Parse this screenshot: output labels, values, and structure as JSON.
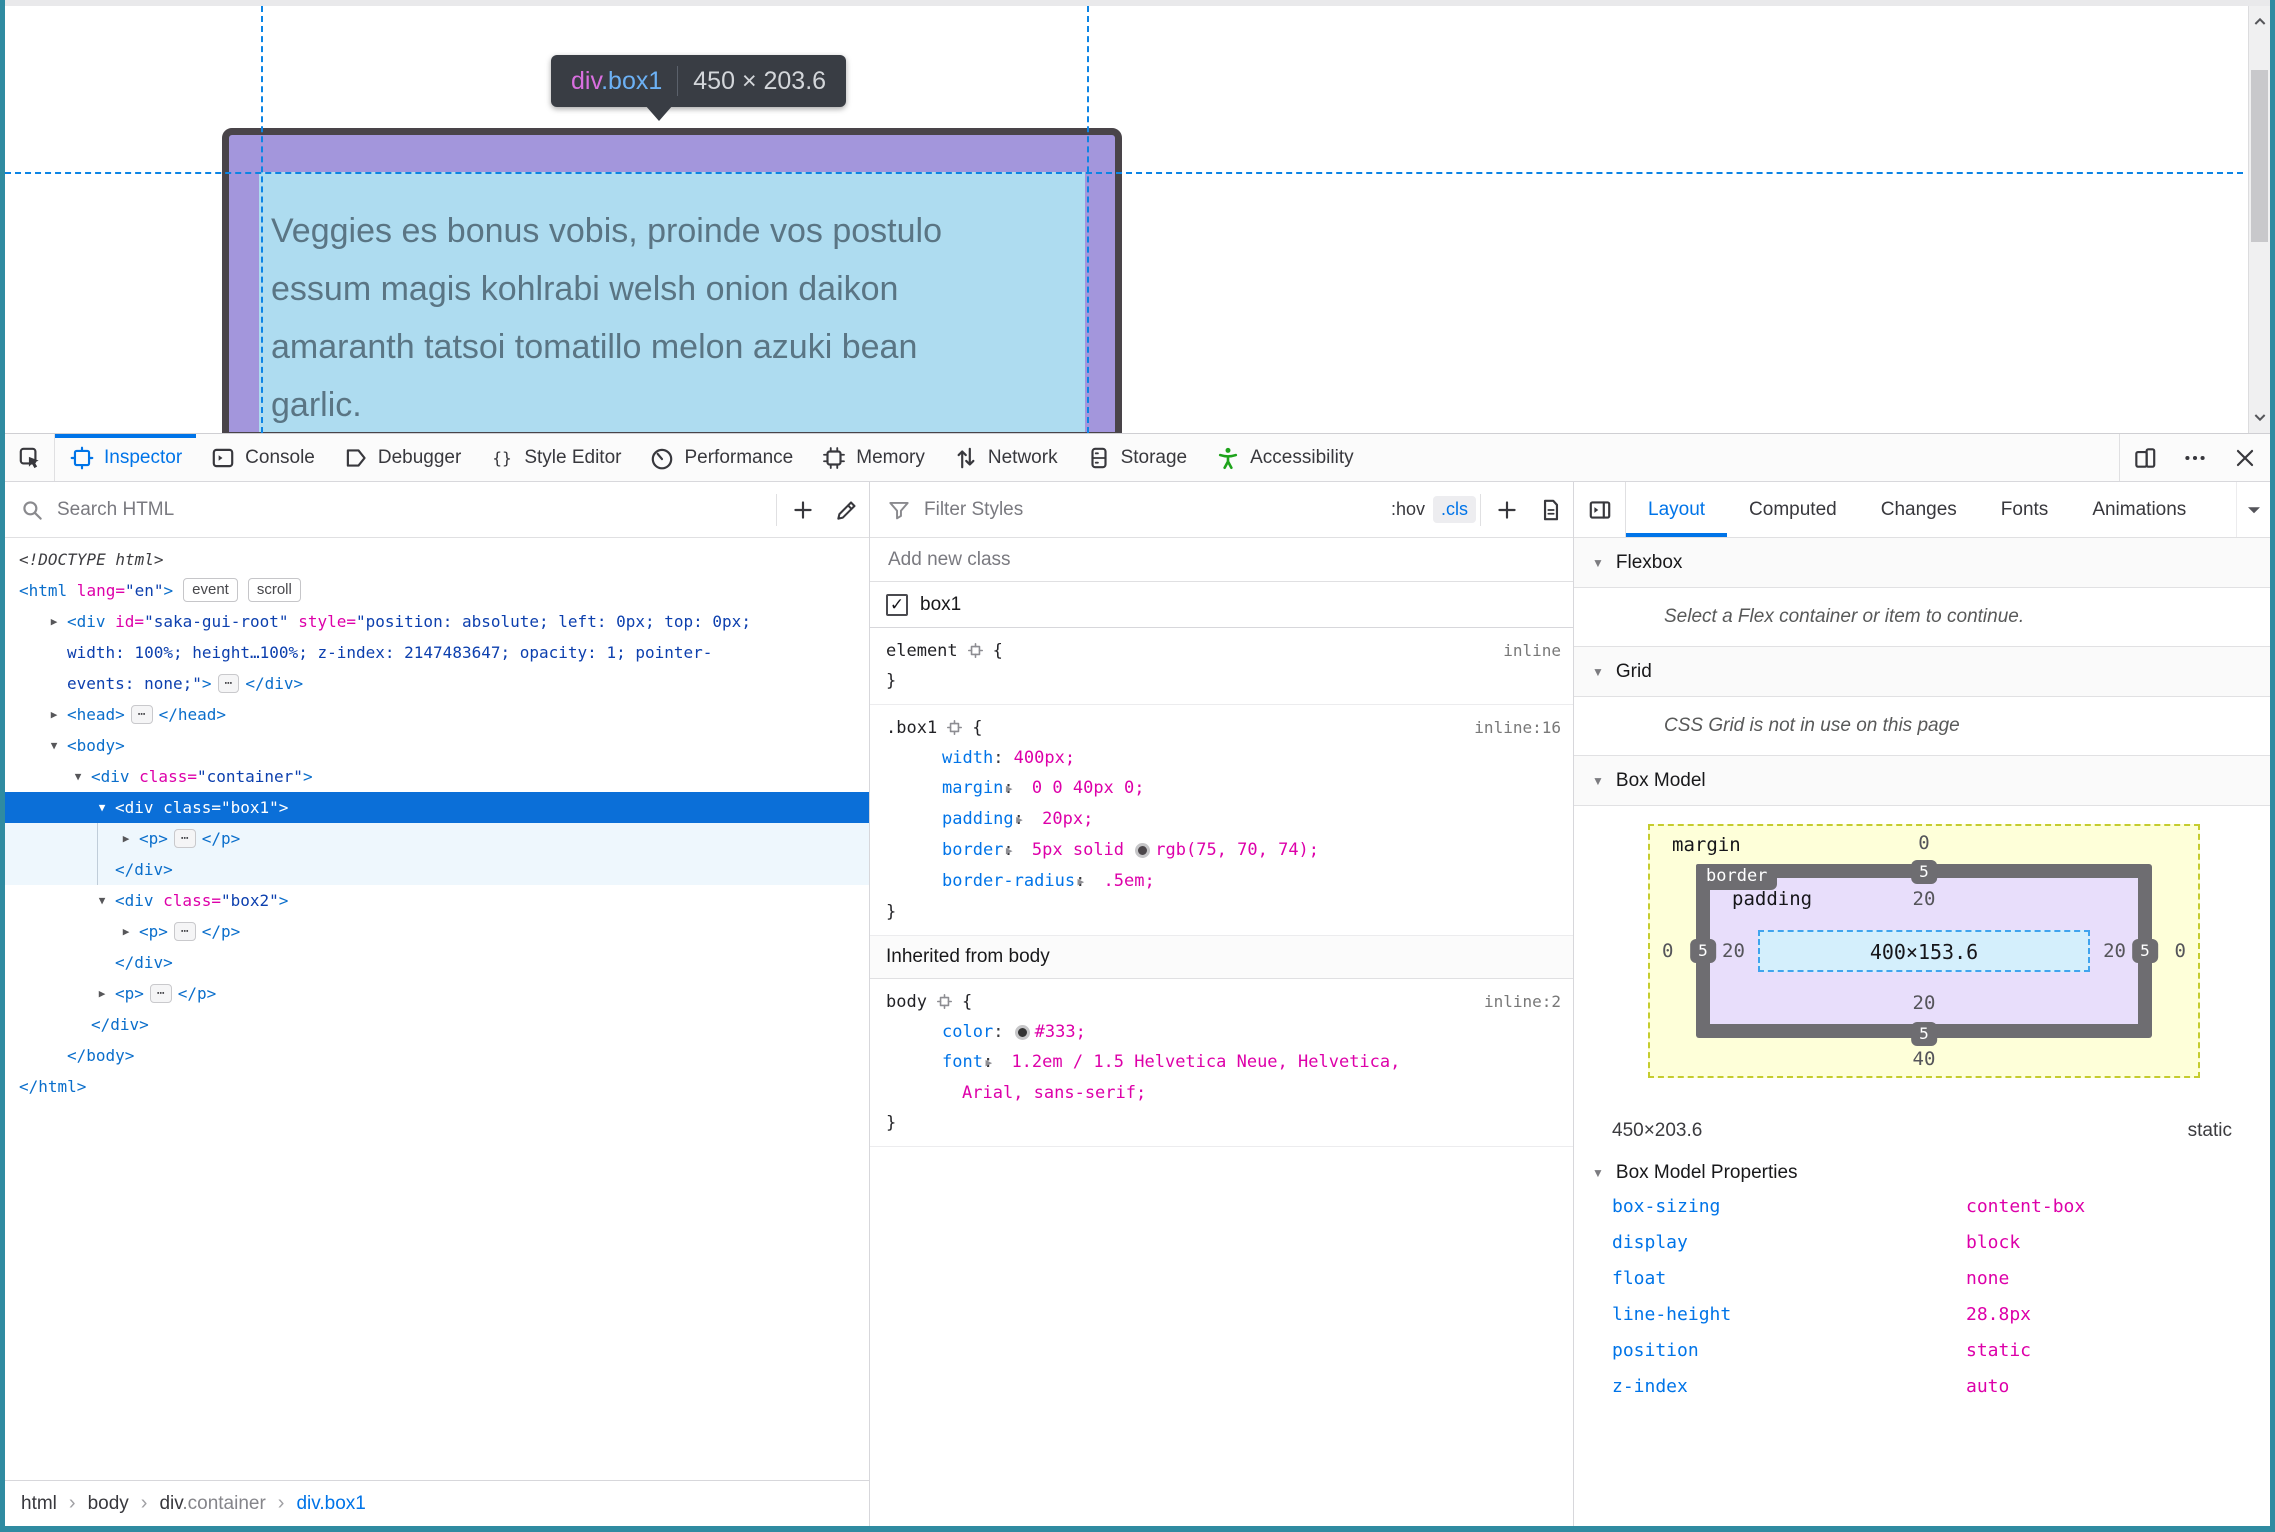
{
  "page": {
    "tooltip": {
      "tag": "div",
      "cls": ".box1",
      "dims": "450 × 203.6"
    },
    "paragraph": "Veggies es bonus vobis, proinde vos postulo essum magis kohlrabi welsh onion daikon amaranth tatsoi tomatillo melon azuki bean garlic.",
    "overlay_colors": {
      "border": "#494449",
      "padding": "#a396dc",
      "content": "#aedcf0",
      "guide": "#0c84e4"
    }
  },
  "toolbar": {
    "tabs": [
      {
        "label": "Inspector",
        "icon": "inspector",
        "active": true
      },
      {
        "label": "Console",
        "icon": "console"
      },
      {
        "label": "Debugger",
        "icon": "debugger"
      },
      {
        "label": "Style Editor",
        "icon": "style-editor"
      },
      {
        "label": "Performance",
        "icon": "performance"
      },
      {
        "label": "Memory",
        "icon": "memory"
      },
      {
        "label": "Network",
        "icon": "network"
      },
      {
        "label": "Storage",
        "icon": "storage"
      },
      {
        "label": "Accessibility",
        "icon": "accessibility",
        "accent": "#1ea31b"
      }
    ],
    "right_icons": [
      "responsive-mode",
      "meatball-menu",
      "close"
    ]
  },
  "markup": {
    "search_placeholder": "Search HTML",
    "lines": [
      {
        "i": 0,
        "toks": [
          [
            "d",
            "<!DOCTYPE html>"
          ]
        ]
      },
      {
        "i": 0,
        "toks": [
          [
            "t",
            "<html"
          ],
          [
            "a",
            " lang="
          ],
          [
            "v",
            "\"en\""
          ],
          [
            "t",
            ">"
          ],
          [
            "badge",
            "event"
          ],
          [
            "badge",
            "scroll"
          ]
        ]
      },
      {
        "i": 1,
        "a": "r",
        "wrap": true,
        "toks": [
          [
            "t",
            "<div"
          ],
          [
            "a",
            " id="
          ],
          [
            "v",
            "\"saka-gui-root\""
          ],
          [
            "a",
            " style="
          ],
          [
            "v",
            "\"position: absolute; left: 0px; top: 0px; width: 100%; height…100%; z-index: 2147483647; opacity: 1; pointer-events: none;\""
          ],
          [
            "t",
            ">"
          ],
          [
            "chip",
            "⋯"
          ],
          [
            "t",
            "</div>"
          ]
        ]
      },
      {
        "i": 1,
        "a": "r",
        "toks": [
          [
            "t",
            "<head>"
          ],
          [
            "chip",
            "⋯"
          ],
          [
            "t",
            "</head>"
          ]
        ]
      },
      {
        "i": 1,
        "a": "d",
        "toks": [
          [
            "t",
            "<body>"
          ]
        ]
      },
      {
        "i": 2,
        "a": "d",
        "toks": [
          [
            "t",
            "<div"
          ],
          [
            "a",
            " class="
          ],
          [
            "v",
            "\"container\""
          ],
          [
            "t",
            ">"
          ]
        ]
      },
      {
        "i": 3,
        "a": "d",
        "sel": true,
        "toks": [
          [
            "t",
            "<div"
          ],
          [
            "a",
            " class="
          ],
          [
            "v",
            "\"box1\""
          ],
          [
            "t",
            ">"
          ]
        ]
      },
      {
        "i": 4,
        "a": "r",
        "hl": true,
        "toks": [
          [
            "t",
            "<p>"
          ],
          [
            "chip",
            "⋯"
          ],
          [
            "t",
            "</p>"
          ]
        ]
      },
      {
        "i": 4,
        "hl": true,
        "toks": [
          [
            "t",
            "</div>"
          ]
        ]
      },
      {
        "i": 3,
        "a": "d",
        "toks": [
          [
            "t",
            "<div"
          ],
          [
            "a",
            " class="
          ],
          [
            "v",
            "\"box2\""
          ],
          [
            "t",
            ">"
          ]
        ]
      },
      {
        "i": 4,
        "a": "r",
        "toks": [
          [
            "t",
            "<p>"
          ],
          [
            "chip",
            "⋯"
          ],
          [
            "t",
            "</p>"
          ]
        ]
      },
      {
        "i": 4,
        "toks": [
          [
            "t",
            "</div>"
          ]
        ]
      },
      {
        "i": 3,
        "a": "r",
        "toks": [
          [
            "t",
            "<p>"
          ],
          [
            "chip",
            "⋯"
          ],
          [
            "t",
            "</p>"
          ]
        ]
      },
      {
        "i": 3,
        "toks": [
          [
            "t",
            "</div>"
          ]
        ]
      },
      {
        "i": 2,
        "toks": [
          [
            "t",
            "</body>"
          ]
        ]
      },
      {
        "i": 0,
        "toks": [
          [
            "t",
            "</html>"
          ]
        ]
      }
    ]
  },
  "rules": {
    "filter_placeholder": "Filter Styles",
    "hov_label": ":hov",
    "cls_label": ".cls",
    "add_class_placeholder": "Add new class",
    "class_toggle": {
      "checked": true,
      "label": "box1"
    },
    "blocks": [
      {
        "type": "rule",
        "selector": "element",
        "loc": "inline",
        "props": []
      },
      {
        "type": "rule",
        "selector": ".box1",
        "loc": "inline:16",
        "props": [
          {
            "n": "width",
            "v": "400px"
          },
          {
            "n": "margin",
            "ar": true,
            "v": "0 0 40px 0"
          },
          {
            "n": "padding",
            "ar": true,
            "v": "20px"
          },
          {
            "n": "border",
            "ar": true,
            "pre": "5px solid ",
            "sw": "#4b464a",
            "v": "rgb(75, 70, 74)"
          },
          {
            "n": "border-radius",
            "ar": true,
            "v": ".5em"
          }
        ]
      },
      {
        "type": "header",
        "text": "Inherited from body"
      },
      {
        "type": "rule",
        "selector": "body",
        "loc": "inline:2",
        "props": [
          {
            "n": "color",
            "sw": "#333",
            "v": "#333"
          },
          {
            "n": "font",
            "ar": true,
            "v": "1.2em / 1.5 Helvetica Neue, Helvetica, Arial, sans-serif"
          }
        ]
      }
    ]
  },
  "layout_panel": {
    "tabs": [
      {
        "label": "Layout",
        "active": true
      },
      {
        "label": "Computed"
      },
      {
        "label": "Changes"
      },
      {
        "label": "Fonts"
      },
      {
        "label": "Animations"
      }
    ],
    "flexbox": {
      "title": "Flexbox",
      "message": "Select a Flex container or item to continue."
    },
    "grid": {
      "title": "Grid",
      "message": "CSS Grid is not in use on this page"
    },
    "box_model": {
      "title": "Box Model",
      "labels": {
        "margin": "margin",
        "border": "border",
        "padding": "padding"
      },
      "margin": {
        "top": "0",
        "right": "0",
        "bottom": "40",
        "left": "0"
      },
      "border": {
        "top": "5",
        "right": "5",
        "bottom": "5",
        "left": "5"
      },
      "padding": {
        "top": "20",
        "right": "20",
        "bottom": "20",
        "left": "20"
      },
      "content": "400×153.6",
      "dims": "450×203.6",
      "position": "static",
      "properties_title": "Box Model Properties",
      "properties": [
        {
          "name": "box-sizing",
          "value": "content-box"
        },
        {
          "name": "display",
          "value": "block"
        },
        {
          "name": "float",
          "value": "none"
        },
        {
          "name": "line-height",
          "value": "28.8px"
        },
        {
          "name": "position",
          "value": "static"
        },
        {
          "name": "z-index",
          "value": "auto"
        }
      ]
    }
  },
  "breadcrumb": {
    "items": [
      {
        "main": "html"
      },
      {
        "main": "body"
      },
      {
        "main": "div",
        "suffix": ".container"
      },
      {
        "main": "div.box1",
        "selected": true
      }
    ]
  }
}
